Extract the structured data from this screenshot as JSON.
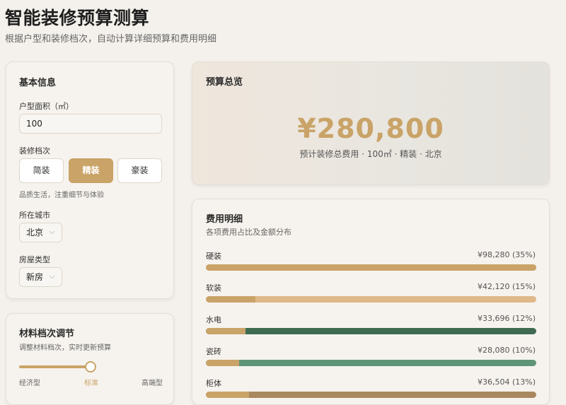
{
  "header": {
    "title": "智能装修预算测算",
    "subtitle": "根据户型和装修档次，自动计算详细预算和费用明细"
  },
  "basic": {
    "title": "基本信息",
    "area_label": "户型面积（㎡）",
    "area_value": "100",
    "tier_label": "装修档次",
    "tiers": [
      "简装",
      "精装",
      "豪装"
    ],
    "tier_note": "品质生活，注重细节与体验",
    "city_label": "所在城市",
    "city_value": "北京",
    "house_label": "房屋类型",
    "house_value": "新房"
  },
  "summary": {
    "title": "预算总览",
    "amount": "¥280,800",
    "desc": "预计装修总费用 · 100㎡ · 精装 · 北京"
  },
  "breakdown": {
    "title": "费用明细",
    "subtitle": "各项费用占比及金额分布",
    "items": [
      {
        "label": "硬装",
        "value": "¥98,280 (35%)",
        "fill": 1.0,
        "fill_color": "#c9a367",
        "track_color": "#c9a367"
      },
      {
        "label": "软装",
        "value": "¥42,120 (15%)",
        "fill": 0.15,
        "fill_color": "#c9a367",
        "track_color": "#e0b889"
      },
      {
        "label": "水电",
        "value": "¥33,696 (12%)",
        "fill": 0.12,
        "fill_color": "#c9a367",
        "track_color": "#3f6b52"
      },
      {
        "label": "瓷砖",
        "value": "¥28,080 (10%)",
        "fill": 0.1,
        "fill_color": "#c9a367",
        "track_color": "#5f9577"
      },
      {
        "label": "柜体",
        "value": "¥36,504 (13%)",
        "fill": 0.13,
        "fill_color": "#c9a367",
        "track_color": "#a98860"
      }
    ]
  },
  "material": {
    "title": "材料档次调节",
    "subtitle": "调整材料档次，实时更新预算",
    "labels": [
      "经济型",
      "标准",
      "高端型"
    ],
    "value_fraction": 0.5
  },
  "colors": {
    "accent": "#c9a367",
    "text": "#2b2b2b"
  }
}
